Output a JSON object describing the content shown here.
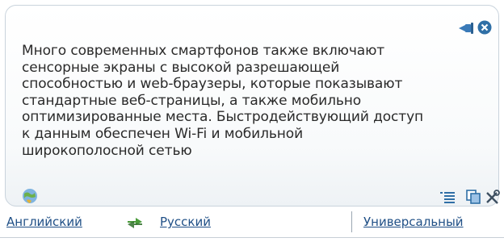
{
  "popup": {
    "text_lines": [
      "Много современных смартфонов также включают",
      "сенсорные экраны с высокой разрешающей",
      "способностью и web-браузеры, которые показывают",
      "стандартные веб-страницы, а также мобильно",
      "оптимизированные места. Быстродействующий доступ",
      "к данным обеспечен Wi-Fi и мобильной",
      "широкополосной сетью"
    ]
  },
  "icons": {
    "pin": "pin-icon",
    "close": "close-icon",
    "globe": "globe-icon",
    "list": "list-icon",
    "copy": "copy-icon",
    "tools": "tools-icon",
    "swap": "swap-arrows-icon"
  },
  "langbar": {
    "from_language": "Английский",
    "to_language": "Русский",
    "dictionary": "Универсальный"
  },
  "colors": {
    "link": "#1f4f86",
    "accent": "#2f6fa6"
  }
}
